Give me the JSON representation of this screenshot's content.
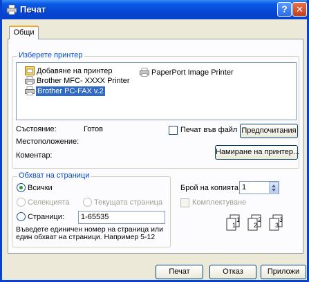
{
  "window": {
    "title": "Печат",
    "help": "?",
    "close": "✕"
  },
  "tabs": [
    {
      "label": "Общи"
    }
  ],
  "printer_group": {
    "legend": "Изберете принтер",
    "items": [
      {
        "label": "Добавяне на принтер",
        "icon": "add-printer-icon"
      },
      {
        "label": "Brother MFC- XXXX   Printer",
        "icon": "printer-icon"
      },
      {
        "label": "Brother PC-FAX v.2",
        "icon": "printer-icon",
        "selected": true
      },
      {
        "label": "PaperPort Image Printer",
        "icon": "printer-icon"
      }
    ],
    "status_label": "Състояние:",
    "status_value": "Готов",
    "location_label": "Местоположение:",
    "comment_label": "Коментар:",
    "print_to_file": "Печат във файл",
    "preferences_button": "Предпочитания",
    "find_printer_button": "Намиране на принтер..."
  },
  "range_group": {
    "legend": "Обхват на страници",
    "all": "Всички",
    "selection": "Селекцията",
    "current_page": "Текущата страница",
    "pages_label": "Страници:",
    "pages_value": "1-65535",
    "hint": "Въведете единичен номер на страница или един обхват на страници. Например 5-12"
  },
  "copies": {
    "label": "Брой на копията:",
    "value": "1",
    "collate": "Комплектуване",
    "collate_pages": [
      "1",
      "1",
      "2",
      "2",
      "3",
      "3"
    ]
  },
  "footer": {
    "print_button": "Печат",
    "cancel_button": "Отказ",
    "apply_button": "Приложи"
  }
}
